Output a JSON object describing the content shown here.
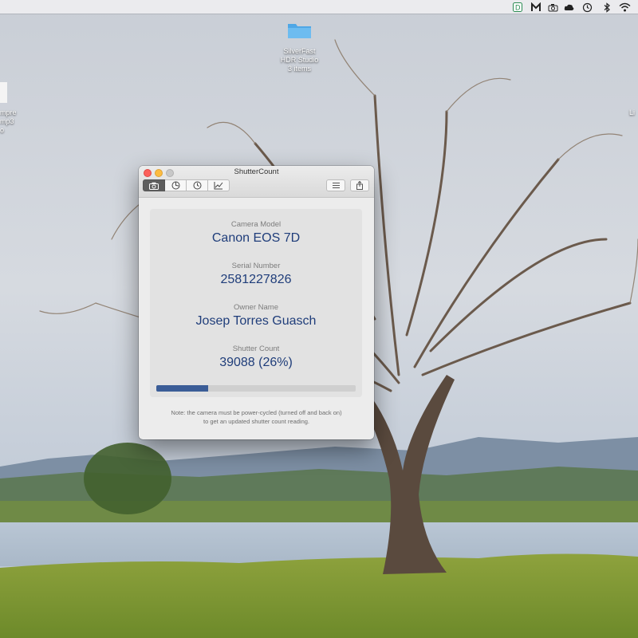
{
  "desktop": {
    "items": [
      {
        "label_line1": "SilverFast",
        "label_line2": "HDR Studio",
        "label_line3": "3 items"
      },
      {
        "label_line1": "mpre",
        "label_line2": "mp3",
        "label_line3": "o"
      },
      {
        "label_line1": "Li"
      }
    ]
  },
  "menubar": {
    "icons": [
      "dash-icon",
      "malwarebytes-icon",
      "camera-icon",
      "cloud-icon",
      "time-machine-icon",
      "bluetooth-icon",
      "wifi-icon"
    ]
  },
  "window": {
    "title": "ShutterCount",
    "toolbar": {
      "tabs": [
        "camera-icon",
        "shutter-icon",
        "clock-icon",
        "chart-icon"
      ],
      "active_tab": 0,
      "right_buttons": [
        "list-icon",
        "share-icon"
      ]
    },
    "fields": {
      "camera_model_label": "Camera Model",
      "camera_model": "Canon EOS 7D",
      "serial_label": "Serial Number",
      "serial": "2581227826",
      "owner_label": "Owner Name",
      "owner": "Josep Torres Guasch",
      "shutter_label": "Shutter Count",
      "shutter": "39088 (26%)"
    },
    "progress_fraction": 0.26,
    "accent_color": "#3b5d97",
    "note_line1": "Note: the camera must be power-cycled (turned off and back on)",
    "note_line2": "to get an updated shutter count reading."
  }
}
